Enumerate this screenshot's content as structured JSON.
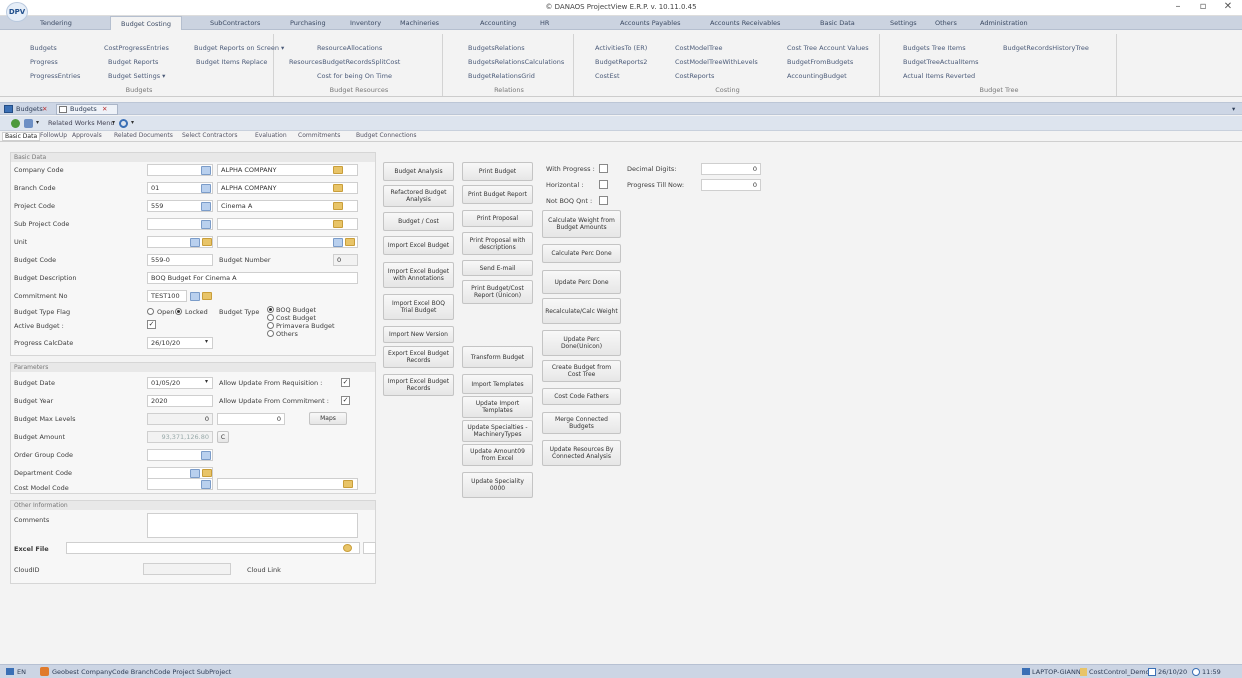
{
  "window": {
    "title": "© DANAOS ProjectView E.R.P. v. 10.11.0.45",
    "logo": "DPV",
    "minimize": "–",
    "maximize": "▫",
    "close": "✕"
  },
  "menu_tabs": [
    "Tendering",
    "Budget Costing",
    "SubContractors",
    "Purchasing",
    "Inventory",
    "Machineries",
    "Accounting",
    "HR",
    "Accounts Payables",
    "Accounts Receivables",
    "Basic Data",
    "Settings",
    "Others",
    "Administration"
  ],
  "ribbon": {
    "budgets": {
      "title": "Budgets",
      "items": [
        "Budgets",
        "CostProgressEntries",
        "Budget Reports on Screen ▾",
        "Progress",
        "Budget Reports",
        "Budget Items Replace",
        "ProgressEntries",
        "Budget Settings ▾"
      ]
    },
    "resources": {
      "title": "Budget Resources",
      "items": [
        "ResourceAllocations",
        "ResourcesBudgetRecordsSplitCost",
        "Cost for being On Time"
      ]
    },
    "relations": {
      "title": "Relations",
      "items": [
        "BudgetsRelations",
        "BudgetsRelationsCalculations",
        "BudgetRelationsGrid"
      ]
    },
    "costing": {
      "title": "Costing",
      "items": [
        "ActivitiesTo (ER)",
        "CostModelTree",
        "Cost Tree Account Values",
        "BudgetReports2",
        "CostModelTreeWithLevels",
        "BudgetFromBudgets",
        "CostEst",
        "CostReports",
        "AccountingBudget"
      ]
    },
    "tree": {
      "title": "Budget Tree",
      "items": [
        "Budgets Tree Items",
        "BudgetRecordsHistoryTree",
        "BudgetTreeActualItems",
        "Actual Items Reverted"
      ]
    }
  },
  "doc_tabs": [
    "Budgets",
    "Budgets"
  ],
  "toolbar": {
    "related": "Related Works Menu"
  },
  "sub_tabs": [
    "Basic Data",
    "FollowUp",
    "Approvals",
    "Related Documents",
    "Select Contractors",
    "Evaluation",
    "Commitments",
    "Budget Connections"
  ],
  "basic": {
    "header": "Basic Data",
    "company_label": "Company Code",
    "company_value": "",
    "company_name": "ALPHA COMPANY",
    "branch_label": "Branch Code",
    "branch_value": "01",
    "branch_name": "ALPHA COMPANY",
    "project_label": "Project Code",
    "project_value": "559",
    "project_name": "Cinema A",
    "subproject_label": "Sub Project Code",
    "unit_label": "Unit",
    "budget_code_label": "Budget Code",
    "budget_code_value": "559-0",
    "budget_number_label": "Budget Number",
    "budget_number_value": "0",
    "desc_label": "Budget Description",
    "desc_value": "BOQ Budget For Cinema A",
    "commit_label": "Commitment No",
    "commit_value": "TEST100",
    "typeflag_label": "Budget Type Flag",
    "open_label": "Open",
    "locked_label": "Locked",
    "budget_type_label": "Budget Type",
    "type_boq": "BOQ Budget",
    "type_cost": "Cost Budget",
    "type_primavera": "Primavera Budget",
    "type_others": "Others",
    "active_label": "Active Budget :",
    "progress_date_label": "Progress CalcDate",
    "progress_date_value": "26/10/20"
  },
  "params": {
    "header": "Parameters",
    "date_label": "Budget Date",
    "date_value": "01/05/20",
    "allow_req": "Allow Update From Requisition :",
    "year_label": "Budget Year",
    "year_value": "2020",
    "allow_commit": "Allow Update From Commitment :",
    "levels_label": "Budget Max Levels",
    "levels_value": "0",
    "levels_value2": "0",
    "maps": "Maps",
    "amount_label": "Budget Amount",
    "amount_value": "93,371,126.80",
    "amount_btn": "C",
    "order_label": "Order Group Code",
    "dept_label": "Department Code",
    "costmodel_label": "Cost Model Code"
  },
  "other": {
    "header": "Other Information",
    "comments_label": "Comments",
    "excel_label": "Excel File",
    "cloud_label": "CloudID",
    "cloud_link": "Cloud Link"
  },
  "buttons_col1": [
    "Budget Analysis",
    "Refactored Budget Analysis",
    "Budget / Cost",
    "Import Excel Budget",
    "Import Excel Budget with Annotations",
    "Import Excel BOQ Trial Budget",
    "Import New Version",
    "Export Excel Budget Records",
    "Import Excel Budget Records"
  ],
  "buttons_col2": [
    "Print Budget",
    "Print Budget Report",
    "Print Proposal",
    "Print Proposal with descriptions",
    "Send E-mail",
    "Print Budget/Cost Report (Unicon)",
    "Transform Budget",
    "Import Templates",
    "Update Import Templates",
    "Update Specialties - MachineryTypes",
    "Update Amount09 from Excel",
    "Update Speciality 0000"
  ],
  "buttons_col3": [
    "Calculate Weight from Budget Amounts",
    "Calculate Perc Done",
    "Update Perc Done",
    "Recalculate/Calc Weight",
    "Update Perc Done(Unicon)",
    "Create Budget from Cost Tree",
    "Cost Code Fathers",
    "Merge Connected Budgets",
    "Update Resources By Connected Analysis"
  ],
  "flags": {
    "with_progress": "With Progress :",
    "horizontal": "Horizontal :",
    "not_boq": "Not BOQ Qnt :",
    "decimal_label": "Decimal Digits:",
    "decimal_value": "0",
    "progress_till_label": "Progress Till Now:",
    "progress_till_value": "0"
  },
  "status": {
    "lang": "EN",
    "text": "Geobest CompanyCode BranchCode Project SubProject",
    "machine": "LAPTOP-GIANNI",
    "db": "CostControl_Demo",
    "date": "26/10/20",
    "time": "11:59"
  }
}
